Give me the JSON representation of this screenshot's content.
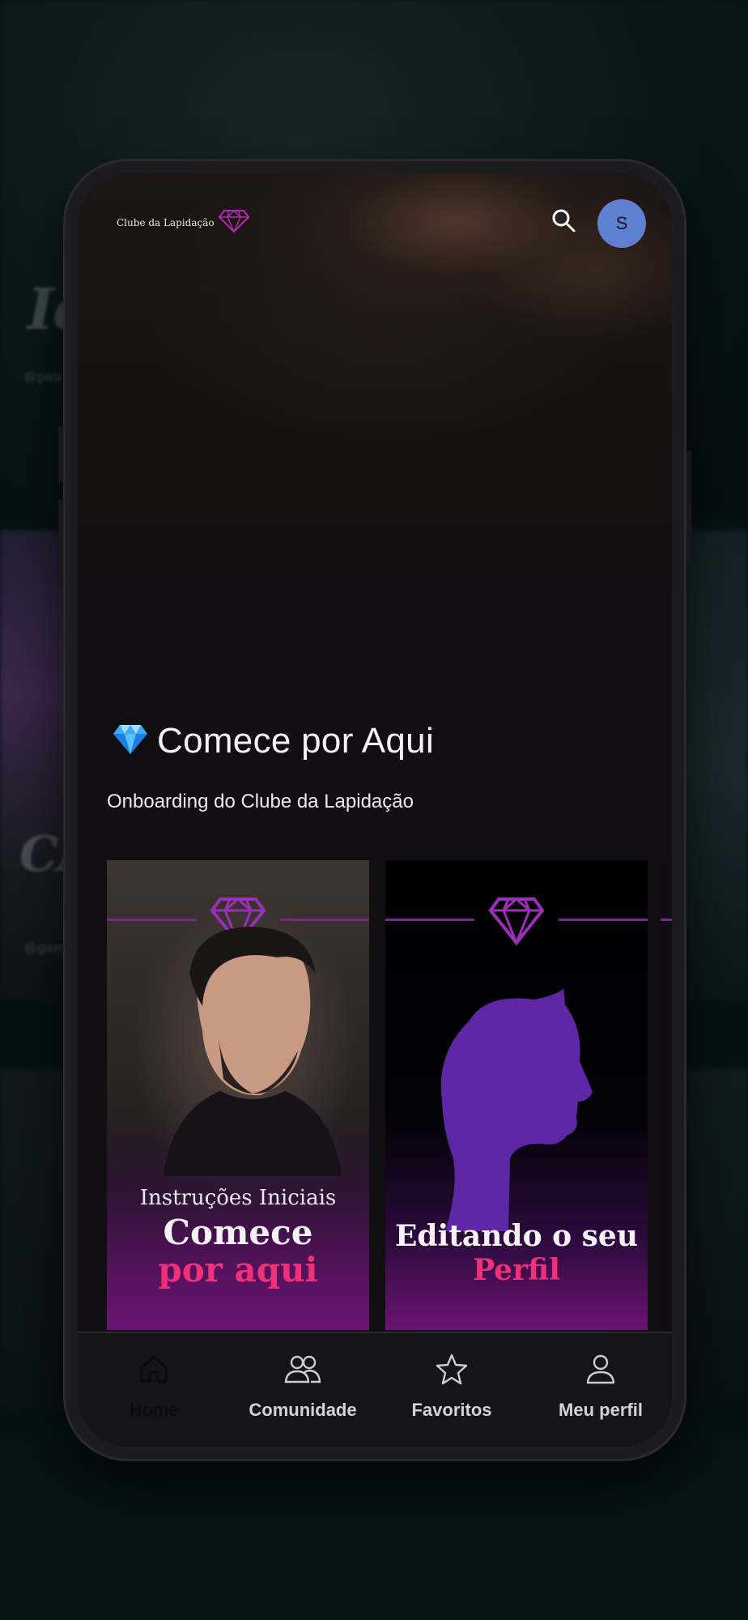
{
  "app": {
    "logo_text": "Clube da Lapidação",
    "avatar_initial": "S"
  },
  "background": {
    "script_text_1": "Ide as",
    "script_text_2": "@pau",
    "script_text_3": "CA",
    "script_text_4": "@gam"
  },
  "section": {
    "title": "Comece por Aqui",
    "subtitle": "Onboarding do Clube da Lapidação"
  },
  "cards": [
    {
      "kicker": "Instruções Iniciais",
      "title_line1": "Comece",
      "title_line2": "por aqui"
    },
    {
      "title_line1": "Editando o seu",
      "title_line2": "Perfil"
    }
  ],
  "nav": [
    {
      "label": "Home",
      "icon": "home-icon",
      "active": true
    },
    {
      "label": "Comunidade",
      "icon": "community-icon",
      "active": false
    },
    {
      "label": "Favoritos",
      "icon": "star-icon",
      "active": false
    },
    {
      "label": "Meu perfil",
      "icon": "user-icon",
      "active": false
    }
  ],
  "colors": {
    "accent_pink": "#f0307a",
    "accent_purple": "#7a2590",
    "avatar_blue": "#5f7fd0"
  }
}
